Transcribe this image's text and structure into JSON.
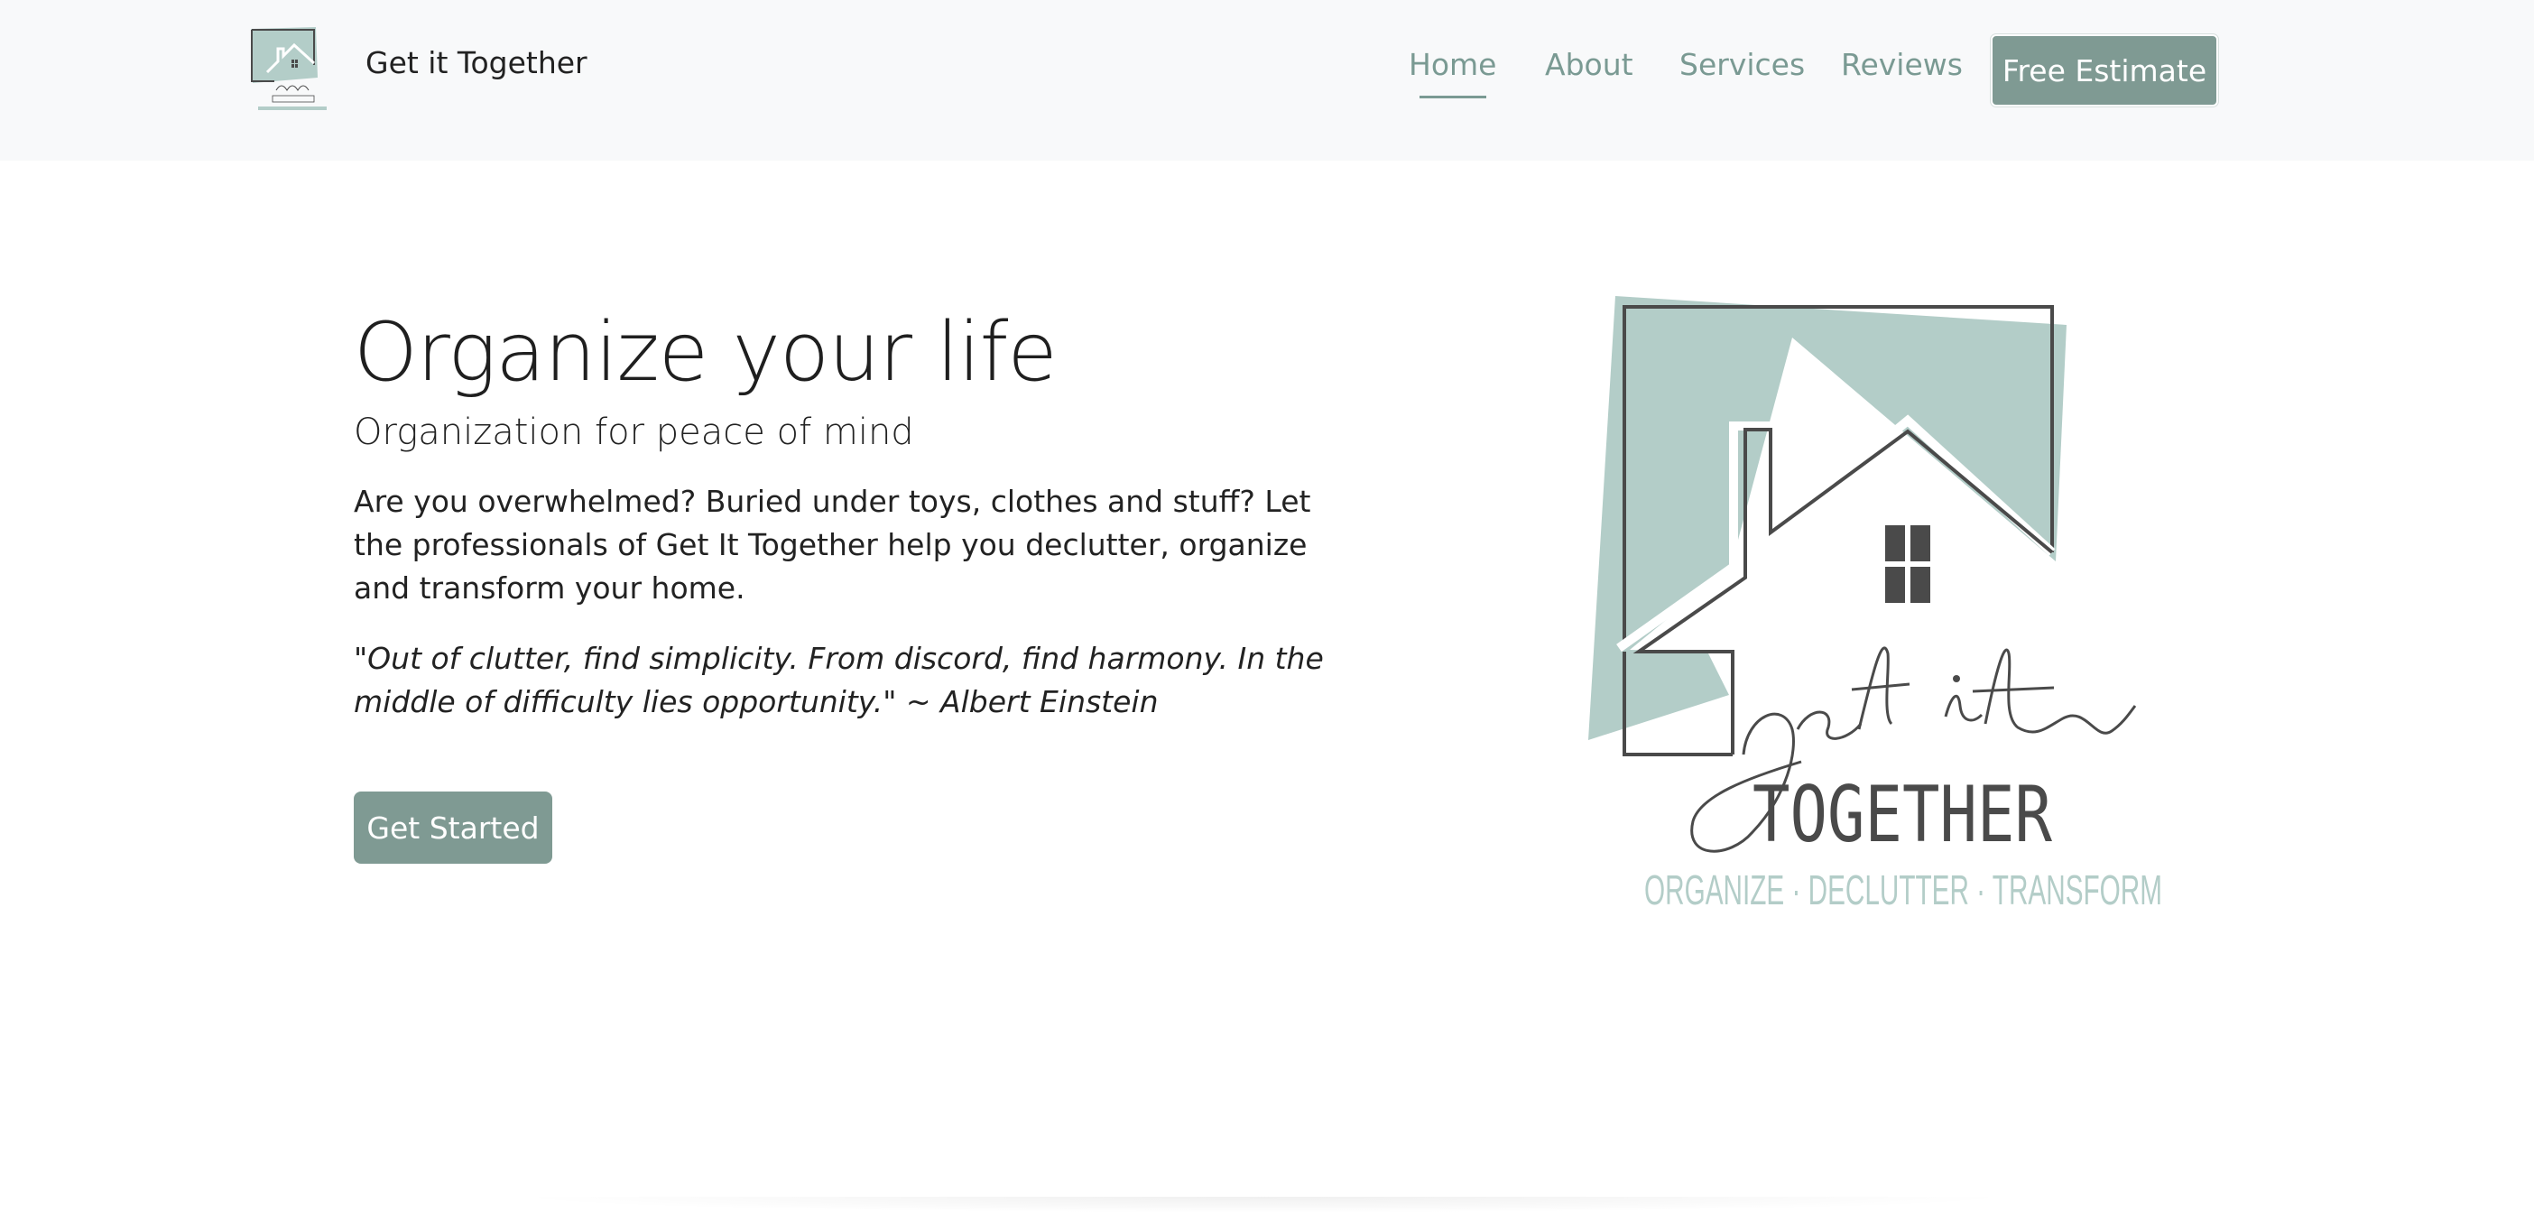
{
  "navbar": {
    "brand_name": "Get it Together",
    "links": [
      {
        "label": "Home",
        "active": true
      },
      {
        "label": "About",
        "active": false
      },
      {
        "label": "Services",
        "active": false
      },
      {
        "label": "Reviews",
        "active": false
      }
    ],
    "cta_label": "Free Estimate"
  },
  "hero": {
    "title": "Organize your life",
    "subtitle": "Organization for peace of mind",
    "text": "Are you overwhelmed? Buried under toys, clothes and stuff? Let the professionals of Get It Together help you declutter, organize and transform your home.",
    "quote": "\"Out of clutter, find simplicity. From discord, find harmony. In the middle of difficulty lies opportunity.\" ~ Albert Einstein",
    "button_label": "Get Started"
  },
  "logo": {
    "script_text": "get it",
    "word_text": "TOGETHER",
    "tagline": "ORGANIZE · DECLUTTER · TRANSFORM"
  },
  "colors": {
    "accent": "#7f9a93",
    "logo_teal": "#b3cdc8",
    "nav_bg": "#f8f9fa",
    "logo_stroke": "#4a4a4a"
  }
}
